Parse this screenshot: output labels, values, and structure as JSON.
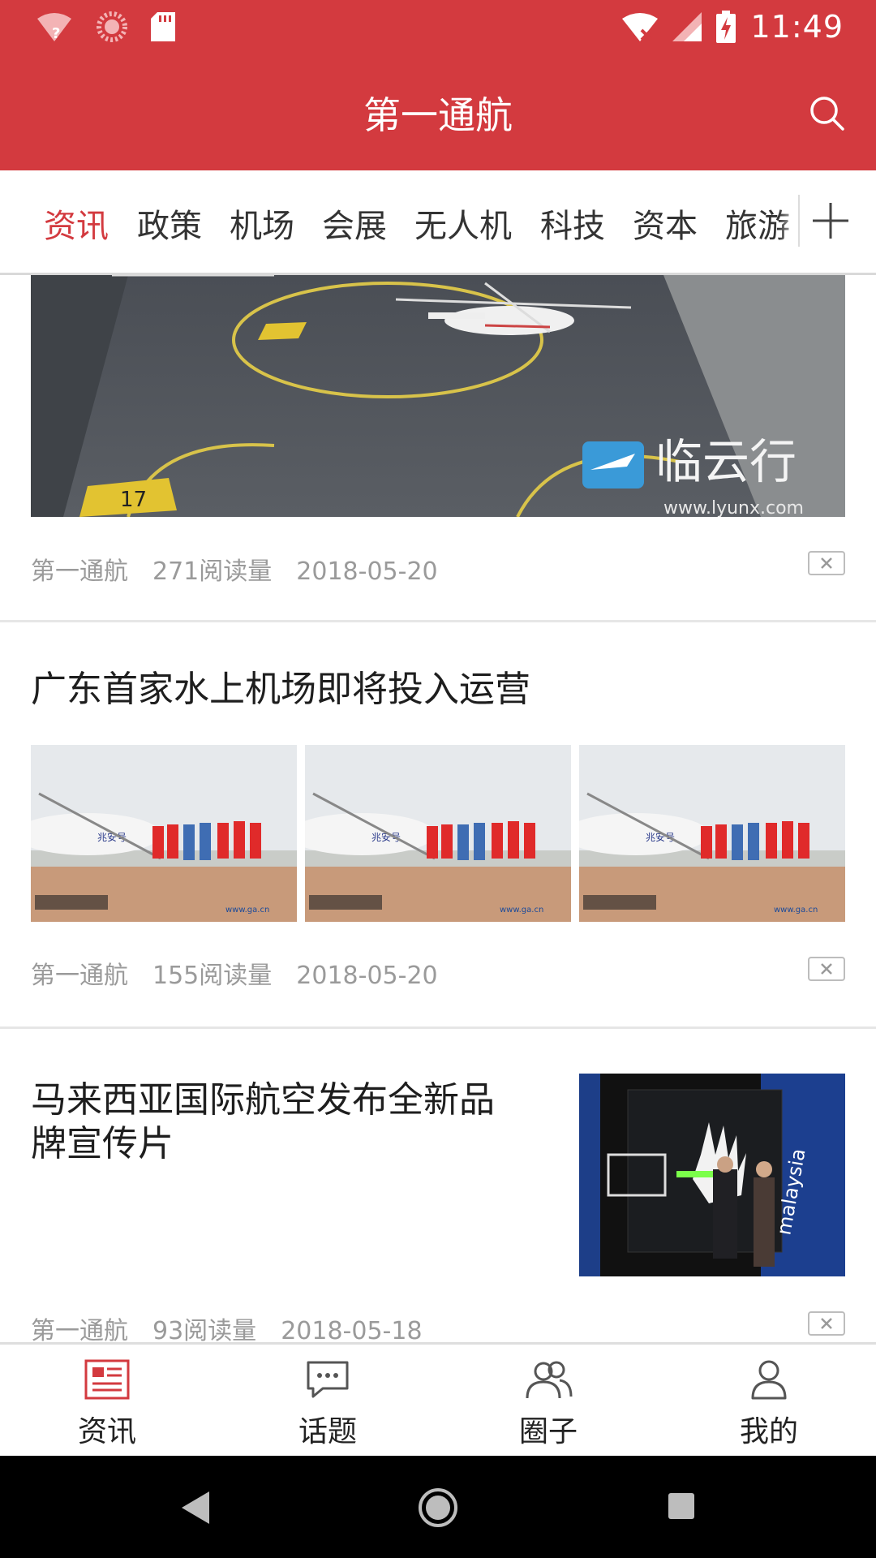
{
  "status_bar": {
    "time": "11:49"
  },
  "app_bar": {
    "title": "第一通航"
  },
  "tabs": [
    {
      "label": "资讯",
      "active": true
    },
    {
      "label": "政策",
      "active": false
    },
    {
      "label": "机场",
      "active": false
    },
    {
      "label": "会展",
      "active": false
    },
    {
      "label": "无人机",
      "active": false
    },
    {
      "label": "科技",
      "active": false
    },
    {
      "label": "资本",
      "active": false
    },
    {
      "label": "旅游",
      "active": false
    }
  ],
  "feed": [
    {
      "source": "第一通航",
      "reads": "271阅读量",
      "date": "2018-05-20",
      "image_watermark": "临云行",
      "image_watermark_url": "www.lyunx.com"
    },
    {
      "title": "广东首家水上机场即将投入运营",
      "source": "第一通航",
      "reads": "155阅读量",
      "date": "2018-05-20"
    },
    {
      "title_line1": "马来西亚国际航空发布全新品",
      "title_line2": "牌宣传片",
      "source": "第一通航",
      "reads": "93阅读量",
      "date": "2018-05-18"
    }
  ],
  "bottom_nav": [
    {
      "label": "资讯",
      "icon": "news-icon",
      "active": true
    },
    {
      "label": "话题",
      "icon": "chat-icon",
      "active": false
    },
    {
      "label": "圈子",
      "icon": "group-icon",
      "active": false
    },
    {
      "label": "我的",
      "icon": "person-icon",
      "active": false
    }
  ],
  "colors": {
    "brand_red": "#d33a3f",
    "meta_gray": "#9a9a9a"
  }
}
